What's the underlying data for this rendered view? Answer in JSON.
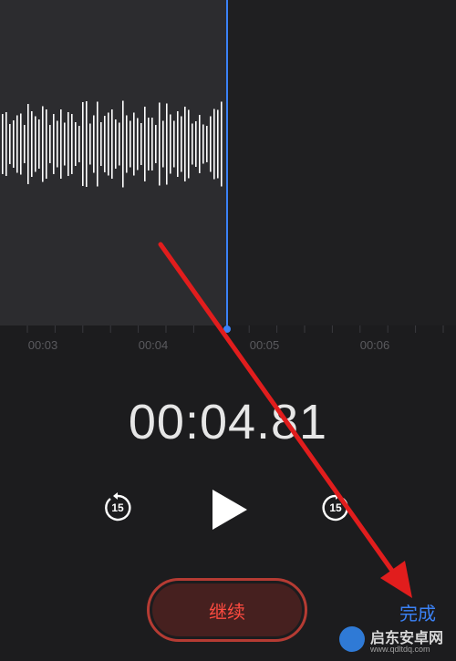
{
  "recording": {
    "timeline_ticks": [
      "00:03",
      "00:04",
      "00:05",
      "00:06"
    ],
    "elapsed_time": "00:04.81"
  },
  "controls": {
    "skip_back_seconds": "15",
    "skip_forward_seconds": "15",
    "resume_label": "继续",
    "done_label": "完成"
  },
  "icons": {
    "skip_back": "rewind-15-icon",
    "play": "play-icon",
    "skip_forward": "forward-15-icon"
  },
  "watermark": {
    "title": "启东安卓网",
    "url": "www.qdltdq.com"
  },
  "colors": {
    "accent": "#3b82f6",
    "record_red": "#ff4b40",
    "annotation_arrow": "#e11d1d"
  }
}
